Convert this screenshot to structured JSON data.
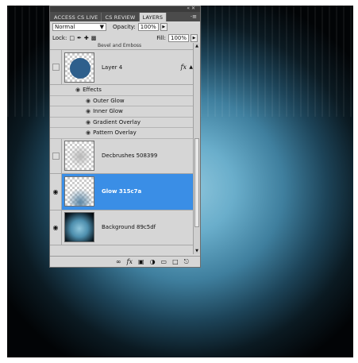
{
  "panel": {
    "top_buttons": "« ✕",
    "tabs": [
      {
        "label": "ACCESS CS LIVE"
      },
      {
        "label": "CS REVIEW"
      },
      {
        "label": "LAYERS"
      }
    ],
    "menu_icon": "·≡",
    "blend_mode": "Normal",
    "opacity_label": "Opacity:",
    "opacity_value": "100%",
    "lock_label": "Lock:",
    "fill_label": "Fill:",
    "fill_value": "100%"
  },
  "layers": {
    "partial_label": "Bevel and Emboss",
    "layer4": {
      "name": "Layer 4",
      "fx": "fx",
      "thumb_color": "#2e5f8c"
    },
    "effects_header": "Effects",
    "effects": [
      "Outer Glow",
      "Inner Glow",
      "Gradient Overlay",
      "Pattern Overlay"
    ],
    "decbrushes": {
      "name": "Decbrushes 508399"
    },
    "glow": {
      "name": "Glow 315c7a",
      "selected_color": "#3a8ee6"
    },
    "background": {
      "name": "Background 89c5df"
    }
  },
  "footer_icons": [
    "link-icon",
    "fx-icon",
    "mask-icon",
    "adjustment-icon",
    "group-icon",
    "new-layer-icon",
    "trash-icon"
  ],
  "colors": {
    "canvas_center": "#8fc6dc",
    "canvas_edge": "#020406"
  }
}
